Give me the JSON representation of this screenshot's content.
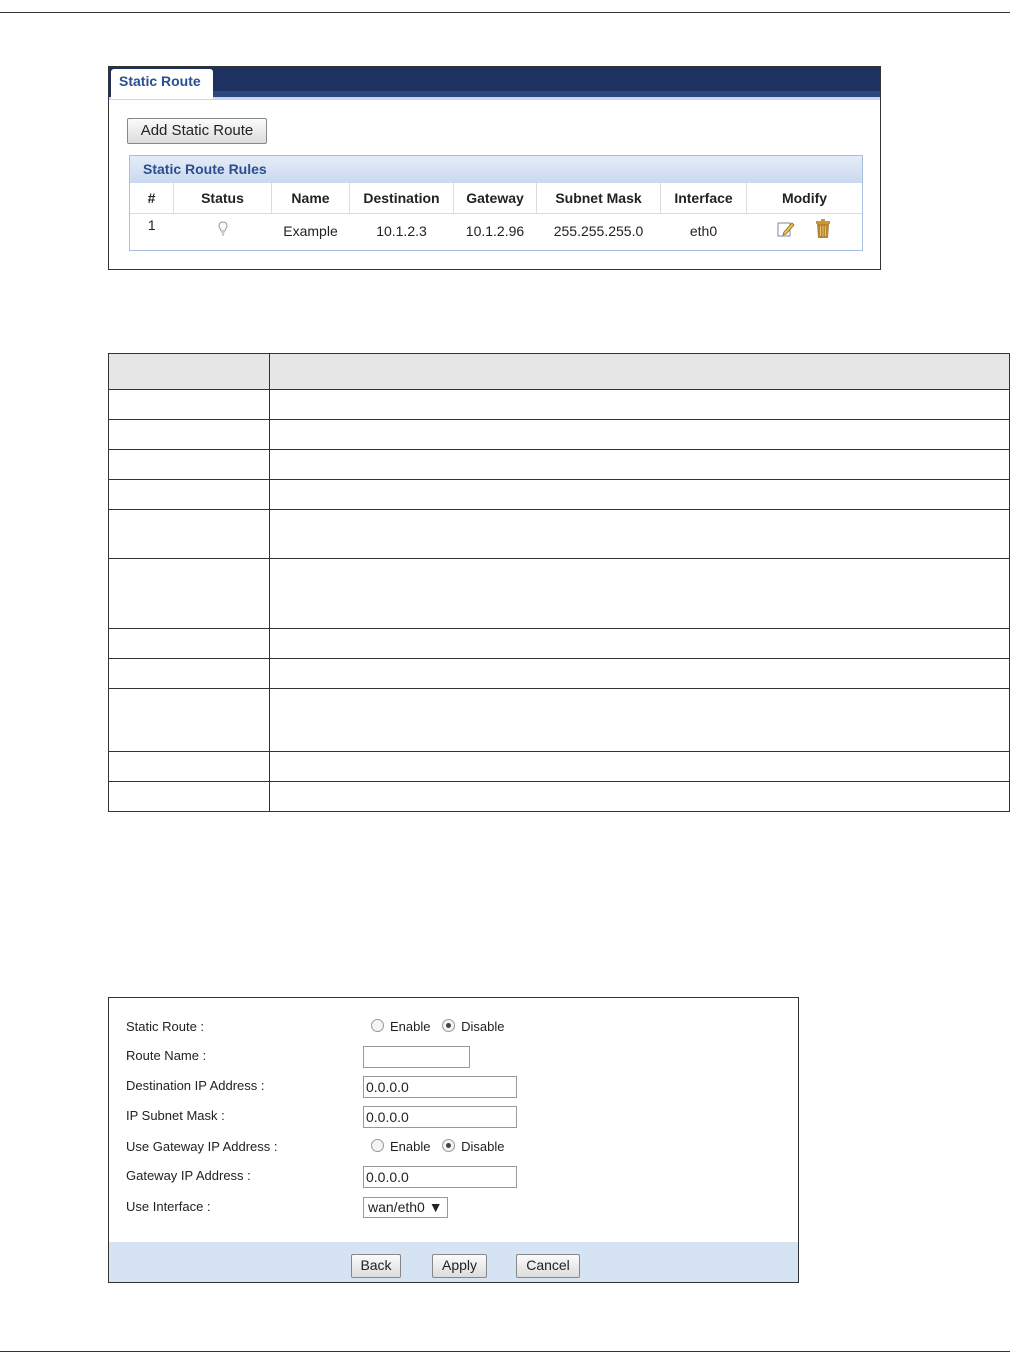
{
  "static_route_page": {
    "tab_label": "Static Route",
    "add_button_label": "Add Static Route",
    "rules_title": "Static Route Rules",
    "columns": [
      "#",
      "Status",
      "Name",
      "Destination",
      "Gateway",
      "Subnet Mask",
      "Interface",
      "Modify"
    ],
    "rows": [
      {
        "index": "1",
        "status_icon": "bulb-off-icon",
        "name": "Example",
        "destination": "10.1.2.3",
        "gateway": "10.1.2.96",
        "subnet_mask": "255.255.255.0",
        "interface": "eth0"
      }
    ],
    "modify_icons": [
      "edit-icon",
      "trash-icon"
    ]
  },
  "doc_table": {
    "rows": 11
  },
  "edit_form": {
    "static_route": {
      "label": "Static Route :",
      "enable": "Enable",
      "disable": "Disable",
      "selected": "Disable"
    },
    "route_name": {
      "label": "Route Name :",
      "value": ""
    },
    "destination_ip": {
      "label": "Destination IP Address :",
      "value": "0.0.0.0"
    },
    "subnet_mask": {
      "label": "IP Subnet Mask :",
      "value": "0.0.0.0"
    },
    "use_gateway": {
      "label": "Use Gateway IP Address :",
      "enable": "Enable",
      "disable": "Disable",
      "selected": "Disable"
    },
    "gateway_ip": {
      "label": "Gateway IP Address :",
      "value": "0.0.0.0"
    },
    "use_interface": {
      "label": "Use Interface :",
      "selected": "wan/eth0"
    },
    "buttons": {
      "back": "Back",
      "apply": "Apply",
      "cancel": "Cancel"
    }
  },
  "colors": {
    "tab_bar": "#1e3160",
    "accent_text": "#2a4f8f",
    "footer_bar": "#d6e3f3",
    "trash": "#b8862f"
  }
}
